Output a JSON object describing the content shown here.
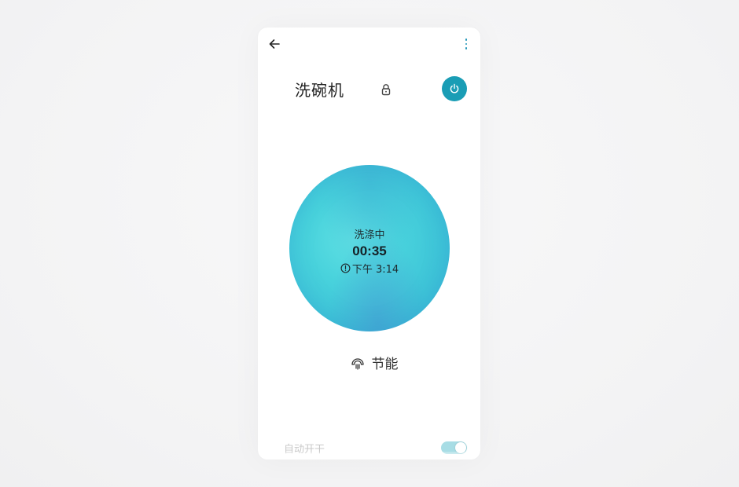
{
  "header": {
    "title": "洗碗机"
  },
  "status": {
    "label": "洗涤中",
    "remaining_time": "00:35",
    "end_time": "下午 3:14"
  },
  "mode": {
    "label": "节能"
  },
  "auto_switch": {
    "label": "自动开干",
    "enabled": true
  },
  "colors": {
    "accent": "#1a9db5",
    "orb": "#48d2dc",
    "toggle_on": "#a8dde5"
  },
  "icons": {
    "back": "arrow-left-icon",
    "more": "more-vertical-icon",
    "lock": "lock-icon",
    "power": "power-icon",
    "clock": "info-clock-icon",
    "mode": "eco-mode-icon"
  }
}
